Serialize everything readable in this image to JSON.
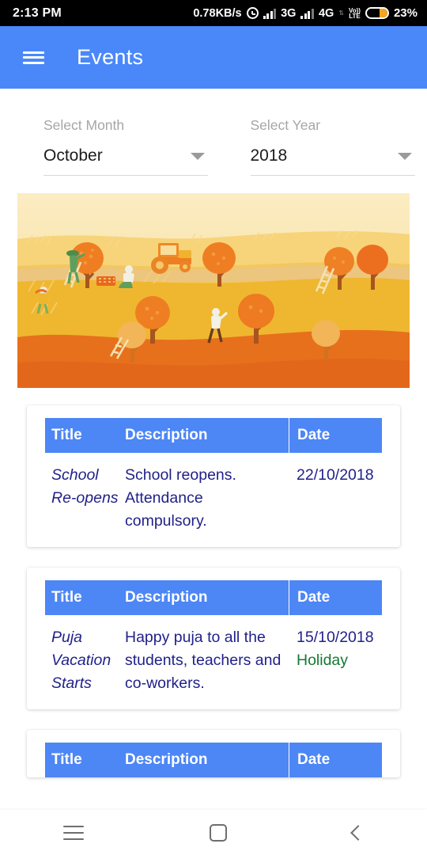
{
  "status_bar": {
    "time": "2:13 PM",
    "net_speed": "0.78KB/s",
    "alarm_icon": "alarm-clock-icon",
    "sim1_label": "3G",
    "sim2_label": "4G",
    "volte_top": "Vo))",
    "volte_bottom": "LTE",
    "battery_percent": "23%"
  },
  "app_bar": {
    "menu_icon": "hamburger-menu-icon",
    "title": "Events"
  },
  "filters": {
    "month": {
      "label": "Select Month",
      "value": "October",
      "caret_icon": "chevron-down-icon"
    },
    "year": {
      "label": "Select Year",
      "value": "2018",
      "caret_icon": "chevron-down-icon"
    }
  },
  "banner": {
    "alt": "autumn-harvest-orchard-illustration",
    "colors": {
      "sky": "#f8e4ab",
      "hill_light": "#f6cd63",
      "field_gold": "#efb52f",
      "foreground": "#e7701d",
      "tree_canopy": "#ef7e22",
      "tree_trunk": "#a8541f"
    }
  },
  "table_headers": {
    "title": "Title",
    "description": "Description",
    "date": "Date"
  },
  "events": [
    {
      "title": "School Re-opens",
      "description": "School reopens. Attendance compulsory.",
      "date": "22/10/2018",
      "tag": ""
    },
    {
      "title": "Puja Vacation Starts",
      "description": "Happy puja to all the students, teachers and co-workers.",
      "date": "15/10/2018",
      "tag": "Holiday"
    }
  ],
  "nav_bar": {
    "recents_icon": "recents-icon",
    "home_icon": "home-square-icon",
    "back_icon": "back-chevron-icon"
  },
  "theme": {
    "primary_blue": "#4a88fa",
    "table_header_blue": "#4d86f5",
    "text_navy": "#21218a",
    "holiday_green": "#137a32",
    "battery_orange": "#f5a623"
  }
}
